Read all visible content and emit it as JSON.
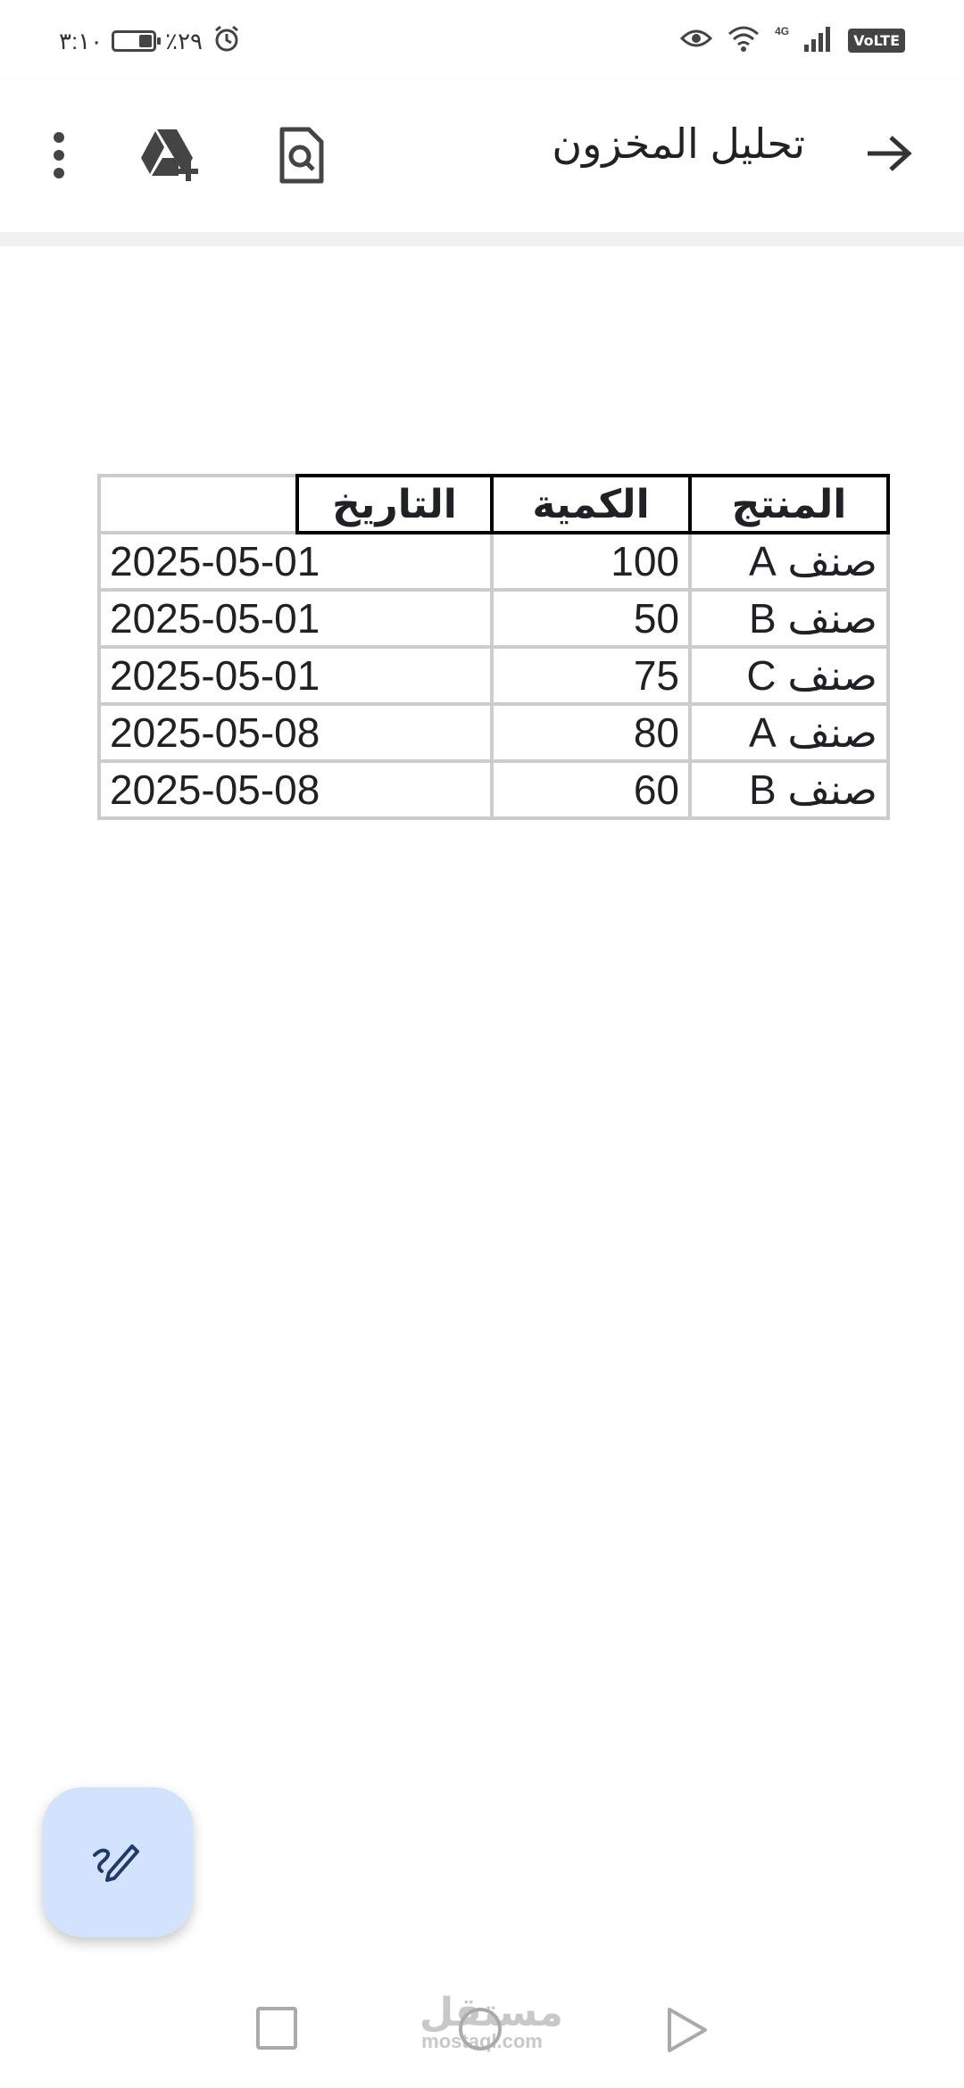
{
  "status_bar": {
    "time": "٣:١٠",
    "battery_percent": "٪٢٩",
    "network": "4G",
    "volte": "VoLTE"
  },
  "app_bar": {
    "title": "تحليل المخزون",
    "icons": [
      "forward-arrow-icon",
      "file-search-icon",
      "drive-add-icon",
      "more-vertical-icon"
    ]
  },
  "table": {
    "headers": [
      "المنتج",
      "الكمية",
      "التاريخ"
    ],
    "rows": [
      [
        "صنف A",
        "100",
        "2025-05-01"
      ],
      [
        "صنف B",
        "50",
        "2025-05-01"
      ],
      [
        "صنف C",
        "75",
        "2025-05-01"
      ],
      [
        "صنف A",
        "80",
        "2025-05-08"
      ],
      [
        "صنف B",
        "60",
        "2025-05-08"
      ]
    ]
  },
  "fab": {
    "icon": "edit-pen-icon"
  },
  "watermark": {
    "arabic": "مستقل",
    "latin": "mostaql.com"
  },
  "nav_bar": {
    "icons": [
      "recents-square-icon",
      "home-circle-icon",
      "back-triangle-icon"
    ]
  }
}
